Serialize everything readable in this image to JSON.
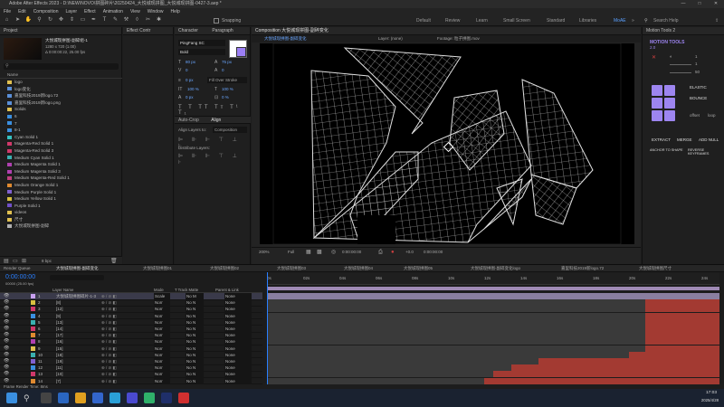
{
  "window": {
    "title": "Adobe After Effects 2023 - D:\\NEW\\NOVO\\拼图碎片\\20250424_大悦城现拼图_大悦城现拼图-0427-3.aep *",
    "controls": [
      "—",
      "□",
      "✕"
    ]
  },
  "menu": [
    "File",
    "Edit",
    "Composition",
    "Layer",
    "Effect",
    "Animation",
    "View",
    "Window",
    "Help"
  ],
  "toolbar": {
    "snapping_label": "Snapping",
    "workspaces": [
      "Default",
      "Review",
      "Learn",
      "Small Screen",
      "Standard",
      "Libraries",
      "MoAE"
    ],
    "active_workspace": "MoAE",
    "search_placeholder": "Search Help"
  },
  "project": {
    "tab": "Project",
    "comp_name": "大悦城现拼图-副碎组-1",
    "comp_info_1": "1280 x 720 (1.00)",
    "comp_info_2": "Δ 0:00:00:22, 25.00 fps",
    "search_placeholder": "",
    "column_name": "Name",
    "items": [
      {
        "label": "logo",
        "color": "#e0c050"
      },
      {
        "label": "logo变化",
        "color": "#5a8fd8"
      },
      {
        "label": "嘉里科技2019新logo.72",
        "color": "#5a8fd8"
      },
      {
        "label": "嘉里科技2019新logo.png",
        "color": "#5a8fd8"
      },
      {
        "label": "Solids",
        "color": "#e0c050"
      },
      {
        "label": "6",
        "color": "#3a8fe0"
      },
      {
        "label": "7",
        "color": "#3a8fe0"
      },
      {
        "label": "8-1",
        "color": "#3a8fe0"
      },
      {
        "label": "Cyan Solid 1",
        "color": "#35c0c0"
      },
      {
        "label": "Magenta-Red Solid 1",
        "color": "#d0386a"
      },
      {
        "label": "Magenta-Red Solid 3",
        "color": "#d0386a"
      },
      {
        "label": "Medium Cyan Solid 1",
        "color": "#3ab0b0"
      },
      {
        "label": "Medium Magenta Solid 1",
        "color": "#b040b0"
      },
      {
        "label": "Medium Magenta Solid 3",
        "color": "#b040b0"
      },
      {
        "label": "Medium Magenta-Red Solid 1",
        "color": "#c04080"
      },
      {
        "label": "Medium Orange Solid 1",
        "color": "#e08a30"
      },
      {
        "label": "Medium Purple Solid 1",
        "color": "#8060d0"
      },
      {
        "label": "Medium Yellow Solid 1",
        "color": "#d8c040"
      },
      {
        "label": "Purple Solid 1",
        "color": "#7050c8"
      },
      {
        "label": "videos",
        "color": "#e0c050"
      },
      {
        "label": "尺寸",
        "color": "#e0c050"
      },
      {
        "label": "大悦城现拼图-副碎",
        "color": "#b0b0b0"
      }
    ],
    "footer_bpc": "8 bpc"
  },
  "effects": {
    "tab": "Effect Contr"
  },
  "character": {
    "tab1": "Character",
    "tab2": "Paragraph",
    "font": "PingFang SC",
    "style": "Bold",
    "size": "80 px",
    "leading": "75 px",
    "kerning": "0",
    "tracking": "0",
    "stroke": "0 px",
    "stroke_mode": "Fill Over Stroke",
    "scale_v": "100 %",
    "scale_h": "100 %",
    "baseline": "0 px",
    "tsume": "0 %",
    "align_tab1": "Auto-Crop",
    "align_tab2": "Align",
    "align_layers_to_label": "Align Layers to:",
    "align_layers_to_value": "Composition",
    "distribute_label": "Distribute Layers:"
  },
  "viewer": {
    "tab": "Composition 大悦城现拼图-副碎变化",
    "subtab": "大悦城现拼图-副碎变化",
    "layer_label": "Layer: (none)",
    "footage_label": "Footage: 粒子拼图.mov",
    "zoom": "200%",
    "quality": "Full",
    "timecode": "0:00:00:00",
    "plus_offset": "+0.0",
    "end_time": "0:00:00:00"
  },
  "motion": {
    "tab": "Motion Tools 2",
    "logo": "MOTION TOOLS",
    "sub_logo": "2.0",
    "values": [
      "1",
      "1",
      "50"
    ],
    "elastic_label": "ELASTIC",
    "bounce_label": "BOUNCE",
    "offset_label": "offset",
    "loop_label": "loop",
    "extract_label": "EXTRACT",
    "merge_label": "MERGE",
    "addnull_label": "ADD NULL",
    "anchor_label": "ANCHOR TO SHAPE",
    "reverse_label": "REVERSE KEYFRAMES"
  },
  "timeline": {
    "render_queue_tab": "Render Queue",
    "tabs": [
      "大悦城现拼图-副碎变化",
      "大悦城现拼图01",
      "大悦城现拼图02",
      "大悦城现拼图03",
      "大悦城现拼图04",
      "大悦城现拼图05",
      "大悦城现拼图-副碎变化logo",
      "嘉里科技2019新logo.72",
      "大悦城现拼图尺寸"
    ],
    "timecode": "0:00:00:00",
    "timecode_sub": "00000 (25.00 fps)",
    "col_layer_name": "Layer Name",
    "col_mode": "Mode",
    "col_trkmat": "T  Track Matte",
    "col_parent": "Parent & Link",
    "ruler": [
      "0s",
      "02s",
      "04s",
      "06s",
      "08s",
      "10s",
      "12s",
      "14s",
      "16s",
      "18s",
      "20s",
      "22s",
      "24s"
    ],
    "layers": [
      {
        "num": "1",
        "name": "大悦城现拼图碎片-1-3",
        "color": "#c8a0f0",
        "mode": "Scale",
        "trk": "No M",
        "parent": "None"
      },
      {
        "num": "2",
        "name": "[8]",
        "color": "#d8c040",
        "mode": "Norr",
        "trk": "No N",
        "parent": "None"
      },
      {
        "num": "3",
        "name": "[12]",
        "color": "#d0386a",
        "mode": "Norr",
        "trk": "No N",
        "parent": "None"
      },
      {
        "num": "4",
        "name": "[9]",
        "color": "#3a8fe0",
        "mode": "Norr",
        "trk": "No N",
        "parent": "None"
      },
      {
        "num": "5",
        "name": "[13]",
        "color": "#3ab0b0",
        "mode": "Norr",
        "trk": "No N",
        "parent": "None"
      },
      {
        "num": "6",
        "name": "[14]",
        "color": "#d0386a",
        "mode": "Norr",
        "trk": "No N",
        "parent": "None"
      },
      {
        "num": "7",
        "name": "[17]",
        "color": "#e08a30",
        "mode": "Norr",
        "trk": "No N",
        "parent": "None"
      },
      {
        "num": "8",
        "name": "[16]",
        "color": "#b040b0",
        "mode": "Norr",
        "trk": "No N",
        "parent": "None"
      },
      {
        "num": "9",
        "name": "[15]",
        "color": "#e0c050",
        "mode": "Norr",
        "trk": "No N",
        "parent": "None"
      },
      {
        "num": "10",
        "name": "[18]",
        "color": "#3ab0b0",
        "mode": "Norr",
        "trk": "No N",
        "parent": "None"
      },
      {
        "num": "11",
        "name": "[19]",
        "color": "#8060d0",
        "mode": "Norr",
        "trk": "No N",
        "parent": "None"
      },
      {
        "num": "12",
        "name": "[11]",
        "color": "#3a8fe0",
        "mode": "Norr",
        "trk": "No N",
        "parent": "None"
      },
      {
        "num": "13",
        "name": "[10]",
        "color": "#d0386a",
        "mode": "Norr",
        "trk": "No N",
        "parent": "None"
      },
      {
        "num": "14",
        "name": "[7]",
        "color": "#e08a30",
        "mode": "Norr",
        "trk": "No N",
        "parent": "None"
      }
    ],
    "footer": "Frame Render Time: 8ms"
  },
  "taskbar": {
    "time": "17:03",
    "date": "2025/4/28"
  },
  "colors": {
    "accent_blue": "#2a7fff",
    "wire": "#d8d8d8",
    "track_red": "#a33a32",
    "workarea": "#9f8ab5"
  }
}
